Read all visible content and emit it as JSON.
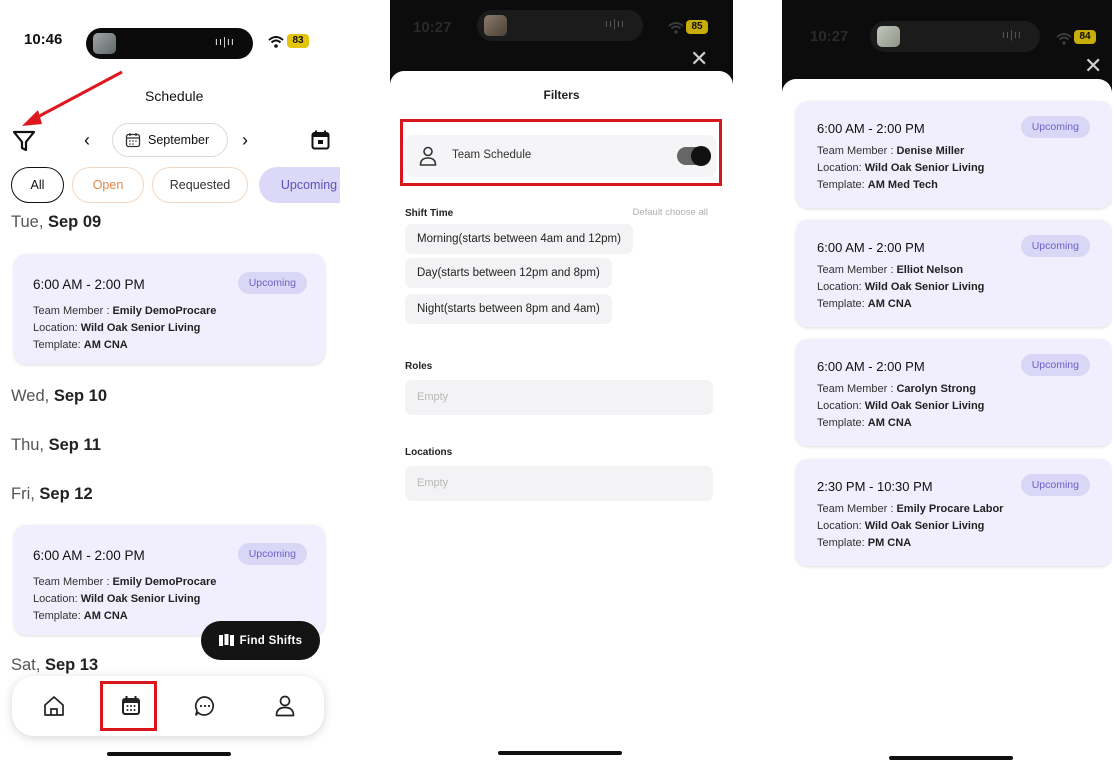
{
  "schedule": {
    "status": {
      "time": "10:46",
      "battery": "83"
    },
    "title": "Schedule",
    "month": "September",
    "chips": [
      "All",
      "Open",
      "Requested",
      "Upcoming"
    ],
    "days": [
      {
        "weekday": "Tue,",
        "date": "Sep 09"
      },
      {
        "weekday": "Wed,",
        "date": "Sep 10"
      },
      {
        "weekday": "Thu,",
        "date": "Sep 11"
      },
      {
        "weekday": "Fri,",
        "date": "Sep 12"
      },
      {
        "weekday": "Sat,",
        "date": "Sep 13"
      }
    ],
    "cards": [
      {
        "time": "6:00 AM - 2:00 PM",
        "badge": "Upcoming",
        "member_label": "Team Member : ",
        "member": "Emily DemoProcare",
        "location_label": "Location: ",
        "location": "Wild Oak Senior Living",
        "template_label": "Template: ",
        "template": "AM CNA"
      },
      {
        "time": "6:00 AM - 2:00 PM",
        "badge": "Upcoming",
        "member_label": "Team Member : ",
        "member": "Emily DemoProcare",
        "location_label": "Location: ",
        "location": "Wild Oak Senior Living",
        "template_label": "Template: ",
        "template": "AM CNA"
      }
    ],
    "find_shifts": "Find Shifts",
    "tabs": [
      "home-icon",
      "calendar-icon",
      "chat-icon",
      "profile-icon"
    ]
  },
  "filters": {
    "status": {
      "time": "10:27",
      "battery": "85"
    },
    "title": "Filters",
    "team_schedule": "Team Schedule",
    "team_schedule_on": true,
    "shift_time_label": "Shift Time",
    "shift_time_hint": "Default choose all",
    "shift_options": [
      "Morning(starts between 4am and 12pm)",
      "Day(starts between 12pm and 8pm)",
      "Night(starts between 8pm and 4am)"
    ],
    "roles_label": "Roles",
    "roles_placeholder": "Empty",
    "locations_label": "Locations",
    "locations_placeholder": "Empty"
  },
  "team": {
    "status": {
      "time": "10:27",
      "battery": "84"
    },
    "cards": [
      {
        "time": "6:00 AM - 2:00 PM",
        "badge": "Upcoming",
        "member_label": "Team Member : ",
        "member": "Denise Miller",
        "location_label": "Location: ",
        "location": "Wild Oak Senior Living",
        "template_label": "Template: ",
        "template": "AM Med Tech"
      },
      {
        "time": "6:00 AM - 2:00 PM",
        "badge": "Upcoming",
        "member_label": "Team Member : ",
        "member": "Elliot Nelson",
        "location_label": "Location: ",
        "location": "Wild Oak Senior Living",
        "template_label": "Template: ",
        "template": "AM CNA"
      },
      {
        "time": "6:00 AM - 2:00 PM",
        "badge": "Upcoming",
        "member_label": "Team Member : ",
        "member": "Carolyn Strong",
        "location_label": "Location: ",
        "location": "Wild Oak Senior Living",
        "template_label": "Template: ",
        "template": "AM CNA"
      },
      {
        "time": "2:30 PM - 10:30 PM",
        "badge": "Upcoming",
        "member_label": "Team Member : ",
        "member": "Emily Procare Labor",
        "location_label": "Location: ",
        "location": "Wild Oak Senior Living",
        "template_label": "Template: ",
        "template": "PM CNA"
      }
    ]
  },
  "colors": {
    "accent": "#5b52b6",
    "card_bg": "#f1effd",
    "badge_bg": "#d9d6f6",
    "highlight": "#d9161c",
    "open_chip": "#e2874b"
  }
}
